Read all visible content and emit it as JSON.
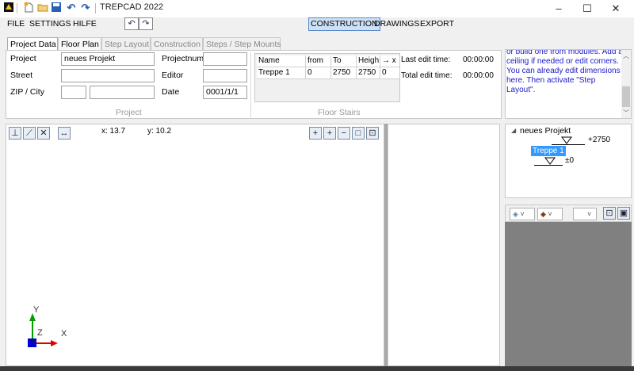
{
  "app": {
    "title": "TREPCAD 2022",
    "window_controls": {
      "minimize": "–",
      "maximize": "☐",
      "close": "✕"
    }
  },
  "quick_access": [
    {
      "name": "app-logo-icon",
      "glyph": "⚑"
    },
    {
      "name": "new-file-icon",
      "glyph": "✎"
    },
    {
      "name": "open-folder-icon",
      "glyph": "▭"
    },
    {
      "name": "save-icon",
      "glyph": "▣"
    },
    {
      "name": "undo-icon",
      "glyph": "↶"
    },
    {
      "name": "redo-icon",
      "glyph": "↷"
    }
  ],
  "menu": {
    "file": "FILE",
    "settings": "SETTINGS",
    "help": "HILFE",
    "undo_glyph": "↶",
    "redo_glyph": "↷"
  },
  "modes": {
    "construction": "CONSTRUCTION",
    "drawings": "DRAWINGS",
    "export": "EXPORT"
  },
  "tabs": [
    {
      "label": "Project Data",
      "state": "on"
    },
    {
      "label": "Floor Plan",
      "state": "sel"
    },
    {
      "label": "Step Layout",
      "state": ""
    },
    {
      "label": "Construction",
      "state": ""
    },
    {
      "label": "Steps / Step Mounts",
      "state": ""
    }
  ],
  "project": {
    "caption": "Project",
    "project_label": "Project",
    "project_value": "neues Projekt",
    "street_label": "Street",
    "street_value": "",
    "zip_label": "ZIP / City",
    "zip_value": "",
    "city_value": "",
    "projectnum_label": "Projectnum",
    "projectnum_value": "",
    "editor_label": "Editor",
    "editor_value": "",
    "date_label": "Date",
    "date_value": "0001/1/1"
  },
  "floor_stairs": {
    "caption": "Floor Stairs",
    "columns": [
      "Name",
      "from",
      "To",
      "Heigh",
      "→ x"
    ],
    "rows": [
      [
        "Treppe 1",
        "0",
        "2750",
        "2750",
        "0"
      ]
    ]
  },
  "edit_times": {
    "last_label": "Last edit time:",
    "last_value": "00:00:00",
    "total_label": "Total edit time:",
    "total_value": "00:00:00"
  },
  "hint": {
    "text": "or build one from modules. Add a ceiling if needed or edit corners. You can already edit dimensions here. Then activate \"Step Layout\"."
  },
  "viewport_toolbar": {
    "left_tools": [
      {
        "name": "perpendicular-tool-icon",
        "glyph": "⊥"
      },
      {
        "name": "diagonal-tool-icon",
        "glyph": "⟋"
      },
      {
        "name": "delete-tool-icon",
        "glyph": "✕"
      },
      {
        "name": "dimension-tool-icon",
        "glyph": "↔"
      }
    ],
    "coord_x": "x: 13.7",
    "coord_y": "y: 10.2",
    "right_tools": [
      {
        "name": "zoom-in-icon",
        "glyph": "+"
      },
      {
        "name": "add-icon",
        "glyph": "+"
      },
      {
        "name": "zoom-out-icon",
        "glyph": "−"
      },
      {
        "name": "frame-icon",
        "glyph": "□"
      },
      {
        "name": "fit-view-icon",
        "glyph": "⊡"
      }
    ]
  },
  "axes": {
    "x_label": "X",
    "y_label": "Y",
    "z_label": "Z"
  },
  "tree": {
    "root": "neues Projekt",
    "top_level": "+2750",
    "stair_name": "Treppe 1",
    "bottom_level": "±0"
  },
  "preview_toolbar": {
    "dropdown1_glyph": "◈",
    "dropdown2_glyph": "◆",
    "fit_glyph": "⊡",
    "snapshot_glyph": "▣"
  },
  "colors": {
    "accent": "#cde0f5",
    "hint_text": "#1a1acd",
    "tree_selected": "#3399ff",
    "preview_bg": "#808080",
    "axis_x": "#e00000",
    "axis_y": "#00a000",
    "axis_z": "#0000d0"
  }
}
